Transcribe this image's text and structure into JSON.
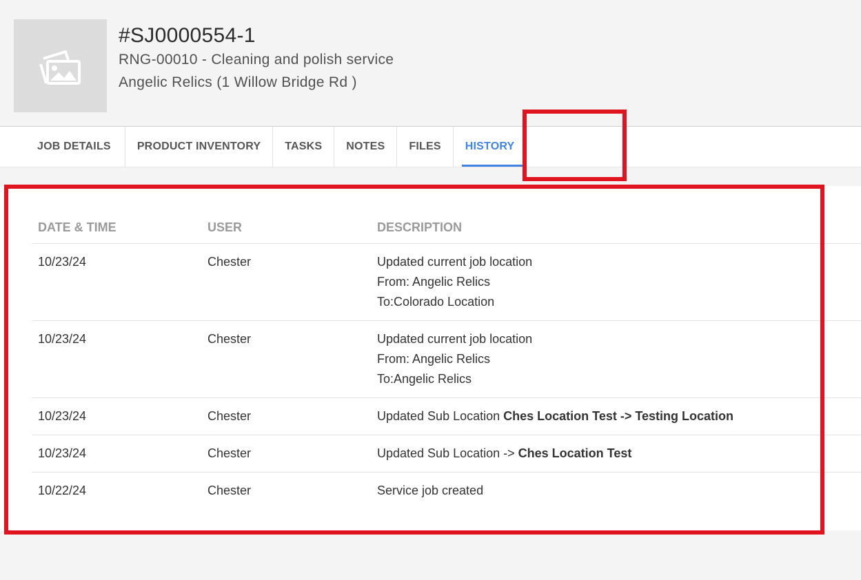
{
  "header": {
    "job_id": "#SJ0000554-1",
    "service_line": "RNG-00010 - Cleaning and polish service",
    "location_line": "Angelic Relics (1 Willow Bridge Rd )",
    "thumbnail_icon": "image-placeholder-icon"
  },
  "tabs": [
    {
      "label": "JOB DETAILS",
      "active": false
    },
    {
      "label": "PRODUCT INVENTORY",
      "active": false
    },
    {
      "label": "TASKS",
      "active": false
    },
    {
      "label": "NOTES",
      "active": false
    },
    {
      "label": "FILES",
      "active": false
    },
    {
      "label": "HISTORY",
      "active": true
    }
  ],
  "history": {
    "columns": {
      "date": "DATE & TIME",
      "user": "USER",
      "description": "DESCRIPTION"
    },
    "rows": [
      {
        "date": "10/23/24",
        "user": "Chester",
        "line1": "Updated current job location",
        "line2": "From: Angelic Relics",
        "line3": "To:Colorado Location"
      },
      {
        "date": "10/23/24",
        "user": "Chester",
        "line1": "Updated current job location",
        "line2": "From: Angelic Relics",
        "line3": "To:Angelic Relics"
      },
      {
        "date": "10/23/24",
        "user": "Chester",
        "prefix": "Updated Sub Location ",
        "bold": "Ches Location Test -> Testing Location"
      },
      {
        "date": "10/23/24",
        "user": "Chester",
        "prefix": "Updated Sub Location -> ",
        "bold": "Ches Location Test"
      },
      {
        "date": "10/22/24",
        "user": "Chester",
        "line1": "Service job created"
      }
    ]
  },
  "colors": {
    "accent": "#3f84e5",
    "highlight": "#e0141e"
  }
}
